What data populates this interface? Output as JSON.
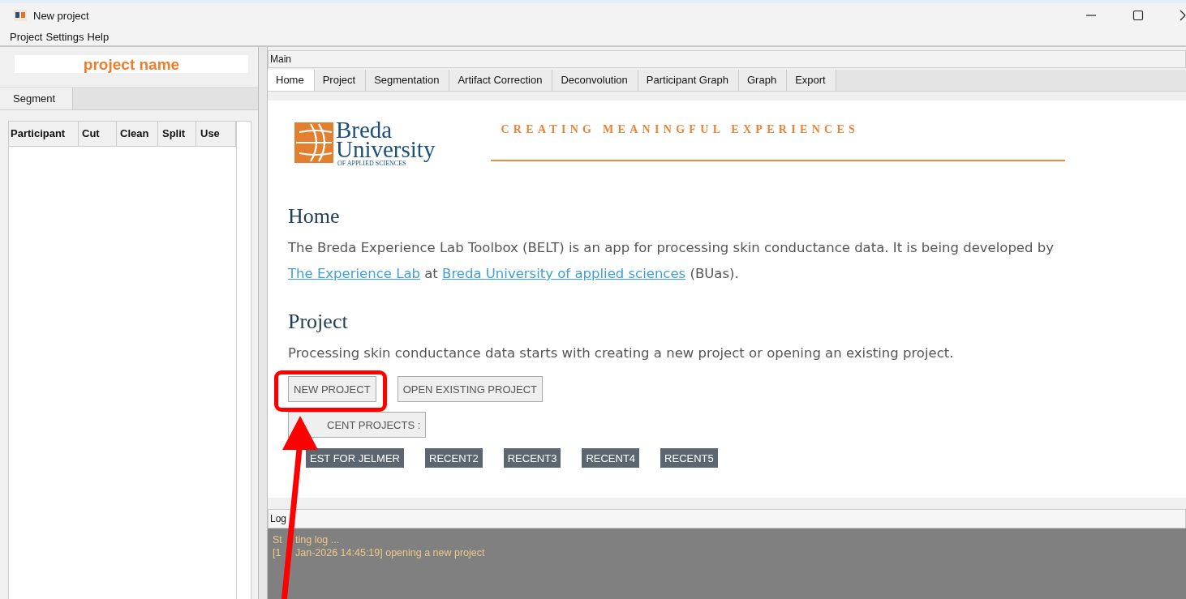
{
  "window": {
    "title": "New project"
  },
  "menu": [
    "Project",
    "Settings",
    "Help"
  ],
  "sidebar": {
    "project_name": "project name",
    "tabs": [
      {
        "label": "Segment",
        "selected": true
      }
    ],
    "columns": [
      "Participant",
      "Cut",
      "Clean",
      "Split",
      "Use"
    ]
  },
  "main": {
    "title": "Main",
    "tabs": [
      {
        "label": "Home",
        "selected": true
      },
      {
        "label": "Project",
        "selected": false
      },
      {
        "label": "Segmentation",
        "selected": false
      },
      {
        "label": "Artifact Correction",
        "selected": false
      },
      {
        "label": "Deconvolution",
        "selected": false
      },
      {
        "label": "Participant Graph",
        "selected": false
      },
      {
        "label": "Graph",
        "selected": false
      },
      {
        "label": "Export",
        "selected": false
      }
    ],
    "logo": {
      "line1": "Breda",
      "line2": "University",
      "line3": "OF APPLIED SCIENCES"
    },
    "tagline": "CREATING MEANINGFUL EXPERIENCES",
    "home_heading": "Home",
    "intro": [
      {
        "text": "The Breda Experience Lab Toolbox (BELT) is an app for processing skin conductance data. It is being developed by ",
        "link": false
      },
      {
        "text": "The Experience Lab",
        "link": true
      },
      {
        "text": " at ",
        "link": false
      },
      {
        "text": "Breda University of applied sciences",
        "link": true
      },
      {
        "text": " (BUas).",
        "link": false
      }
    ],
    "project_heading": "Project",
    "project_text": "Processing skin conductance data starts with creating a new project or opening an existing project.",
    "buttons": [
      "NEW PROJECT",
      "OPEN EXISTING PROJECT"
    ],
    "recent_label": "CENT PROJECTS :",
    "recent": [
      "EST FOR JELMER",
      "RECENT2",
      "RECENT3",
      "RECENT4",
      "RECENT5"
    ]
  },
  "log": {
    "title": "Log",
    "lines": [
      {
        "before": "St",
        "after": "ting log ..."
      },
      {
        "before": "[1",
        "after": "Jan-2026 14:45:19] opening a new project"
      }
    ]
  }
}
